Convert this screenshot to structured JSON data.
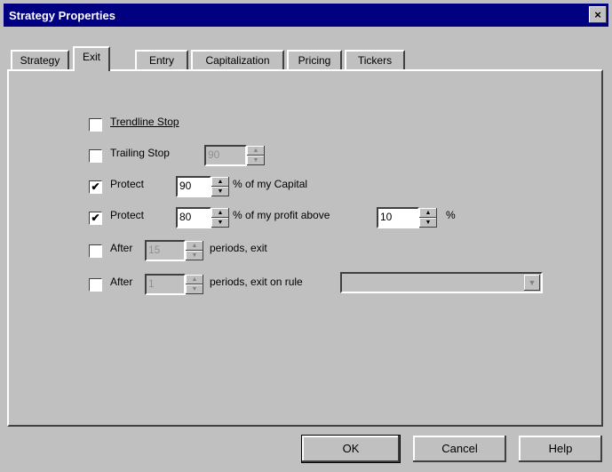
{
  "window": {
    "title": "Strategy Properties",
    "close_glyph": "×"
  },
  "tabs": [
    {
      "label": "Strategy",
      "active": false
    },
    {
      "label": "Exit",
      "active": true
    },
    {
      "label": "Entry",
      "active": false
    },
    {
      "label": "Capitalization",
      "active": false
    },
    {
      "label": "Pricing",
      "active": false
    },
    {
      "label": "Tickers",
      "active": false
    }
  ],
  "exit": {
    "trendline_stop": {
      "label": "Trendline Stop",
      "checked": false
    },
    "trailing_stop": {
      "label": "Trailing Stop",
      "checked": false,
      "value": "90"
    },
    "protect_capital": {
      "label": "Protect",
      "checked": true,
      "value": "90",
      "suffix": "% of my Capital"
    },
    "protect_profit": {
      "label": "Protect",
      "checked": true,
      "value": "80",
      "middle": "% of my profit above",
      "value2": "10",
      "suffix": "%"
    },
    "after_periods": {
      "label": "After",
      "checked": false,
      "value": "15",
      "suffix": "periods, exit"
    },
    "after_rule": {
      "label": "After",
      "checked": false,
      "value": "1",
      "suffix": "periods, exit on rule",
      "rule_value": ""
    }
  },
  "buttons": {
    "ok": "OK",
    "cancel": "Cancel",
    "help": "Help"
  },
  "glyphs": {
    "check": "✔",
    "up": "▲",
    "down": "▼"
  },
  "colors": {
    "face": "#c0c0c0",
    "titlebar": "#000080"
  }
}
